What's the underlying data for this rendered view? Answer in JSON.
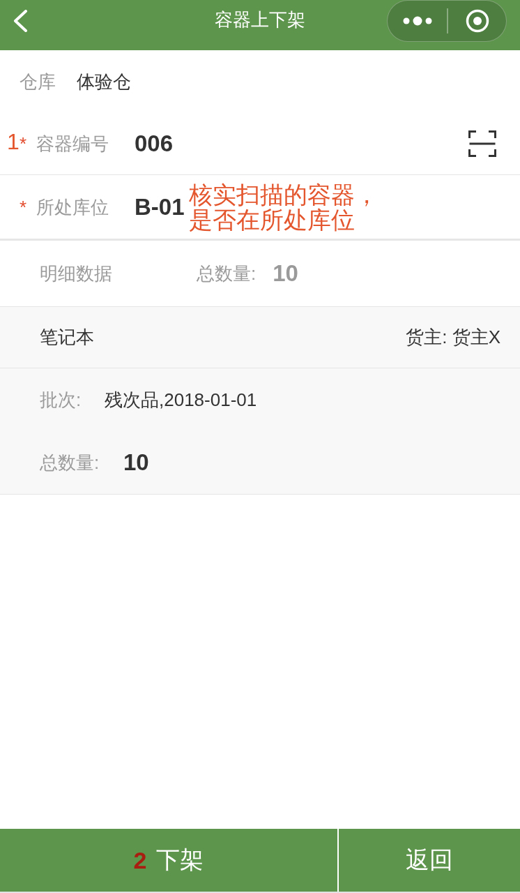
{
  "nav_bar": {
    "title": "容器上下架"
  },
  "form": {
    "rows": [
      {
        "kind": "text",
        "label": "仓库",
        "value": "体验仓"
      },
      {
        "kind": "scan",
        "annotation_number": "1",
        "required_mark": "*",
        "label": "容器编号",
        "value": "006"
      },
      {
        "kind": "input",
        "required_mark": "*",
        "label": "所处库位",
        "value": "B-01",
        "annotation_note": "核实扫描的容器，是否在所处库位"
      }
    ]
  },
  "details": {
    "title": "明细数据",
    "total_label": "总数量:",
    "total": "10",
    "items": [
      {
        "name": "笔记本",
        "owner": "货主: 货主X",
        "batch_label": "批次:",
        "batch": "残次品,2018-01-01",
        "quantity_label": "总数量:",
        "quantity": "10"
      }
    ]
  },
  "actions": [
    {
      "kind": "primary",
      "annotation_number": "2",
      "label": "下架"
    },
    {
      "kind": "secondary",
      "label": "返回"
    }
  ]
}
